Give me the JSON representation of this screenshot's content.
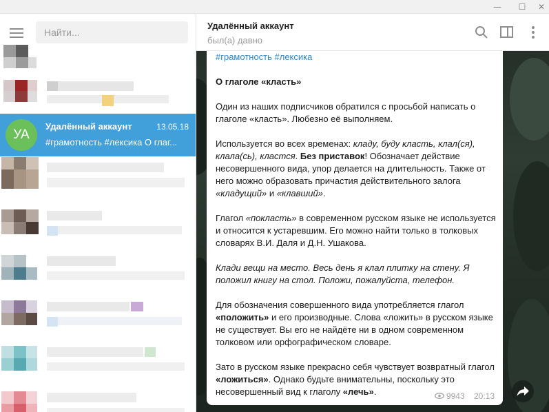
{
  "window": {
    "minimize_glyph": "—",
    "maximize_glyph": "☐",
    "close_glyph": "✕"
  },
  "sidebar": {
    "search": {
      "placeholder": "Найти..."
    },
    "active_chat": {
      "avatar_initials": "УА",
      "avatar_color": "#6cc05a",
      "name": "Удалённый аккаунт",
      "date": "13.05.18",
      "preview": "#грамотность #лексика  О глаг..."
    }
  },
  "header": {
    "title": "Удалённый аккаунт",
    "status": "был(а) давно",
    "icons": [
      "search-icon",
      "sidebar-toggle-icon",
      "more-vertical-icon"
    ]
  },
  "message": {
    "tags": "#грамотность #лексика",
    "heading": "О глаголе «класть»",
    "p1": "Один из наших подписчиков обратился с просьбой написать о глаголе «класть». Любезно её выполняем.",
    "p2_a": "Используется во всех временах: ",
    "p2_i1": "кладу, буду класть, клал(ся), клала(сь), кластся",
    "p2_b": ". ",
    "p2_bold": "Без приставок",
    "p2_c": "! Обозначает действие несовершенного вида, упор делается на длительность. Также от него можно образовать причастия действительного залога ",
    "p2_i2": "«кладущий»",
    "p2_d": " и ",
    "p2_i3": "«клавший»",
    "p2_e": ".",
    "p3_a": "Глагол ",
    "p3_i": "«покласть»",
    "p3_b": " в современном русском языке не используется и относится к устаревшим. Его можно найти только в толковых словарях В.И. Даля и Д.Н. Ушакова.",
    "p4_i": "Клади вещи на место. Весь день я клал плитку на стену. Я положил книгу на стол. Положи, пожалуйста, телефон.",
    "p5_a": "Для обозначения совершенного вида употребляется глагол ",
    "p5_bold": "«положить»",
    "p5_b": " и его производные. Слова «ложить» в русском языке не существует. Вы его не найдёте ни в одном современном толковом или орфографическом словаре.",
    "p6_a": "Зато в русском языке прекрасно себя чувствует возвратный глагол ",
    "p6_bold1": "«ложиться»",
    "p6_b": ". Однако будьте внимательны, поскольку это несовершенный вид к глаголу ",
    "p6_bold2": "«лечь»",
    "p6_c": ".",
    "views": "9943",
    "time": "20:13"
  },
  "colors": {
    "accent": "#419fd9",
    "hashtag": "#2e87c8"
  }
}
